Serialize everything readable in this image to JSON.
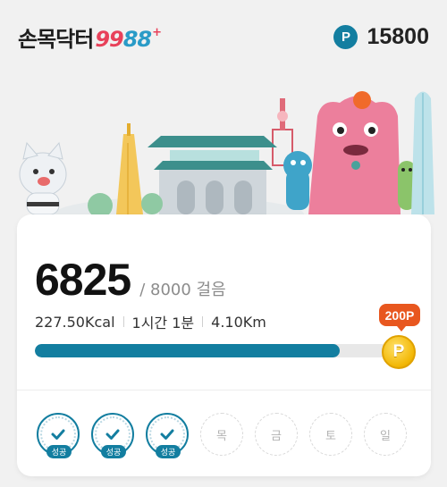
{
  "header": {
    "logo_text": "손목닥터",
    "logo_num_a": "99",
    "logo_num_b": "88",
    "logo_plus": "+",
    "points_icon_letter": "P",
    "points_value": "15800"
  },
  "steps": {
    "count": "6825",
    "goal": "/ 8000 걸음",
    "progress": 0.853
  },
  "stats": {
    "calories": "227.50Kcal",
    "duration": "1시간 1분",
    "distance": "4.10Km"
  },
  "reward": {
    "tag": "200P",
    "coin_letter": "P"
  },
  "week": {
    "days": [
      {
        "label": "",
        "status": "done",
        "badge": "성공"
      },
      {
        "label": "",
        "status": "done",
        "badge": "성공"
      },
      {
        "label": "",
        "status": "done",
        "badge": "성공"
      },
      {
        "label": "목",
        "status": "todo"
      },
      {
        "label": "금",
        "status": "todo"
      },
      {
        "label": "토",
        "status": "todo"
      },
      {
        "label": "일",
        "status": "todo"
      }
    ]
  },
  "colors": {
    "accent": "#137ea0",
    "brand_red": "#e8415a",
    "reward_orange": "#e8571f",
    "coin_gold": "#f2b705"
  }
}
